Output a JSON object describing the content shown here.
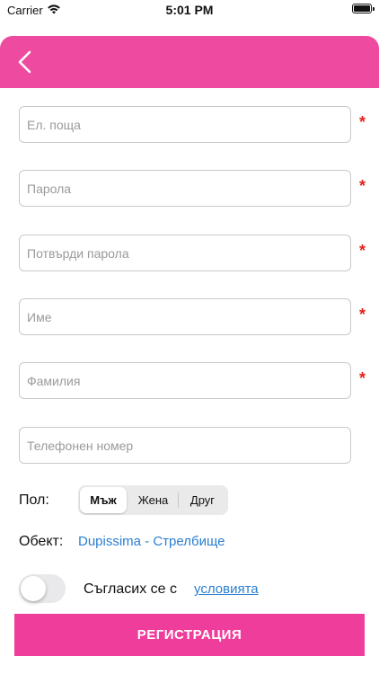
{
  "status_bar": {
    "carrier": "Carrier",
    "time": "5:01 PM",
    "wifi_icon": "wifi-icon",
    "battery_icon": "battery-icon"
  },
  "header": {
    "back_icon": "chevron-left-icon",
    "color": "#ee4ba0"
  },
  "form": {
    "email": {
      "placeholder": "Ел. поща",
      "value": "",
      "required": true
    },
    "password": {
      "placeholder": "Парола",
      "value": "",
      "required": true
    },
    "confirm_password": {
      "placeholder": "Потвърди парола",
      "value": "",
      "required": true
    },
    "first_name": {
      "placeholder": "Име",
      "value": "",
      "required": true
    },
    "last_name": {
      "placeholder": "Фамилия",
      "value": "",
      "required": true
    },
    "phone": {
      "placeholder": "Телефонен номер",
      "value": "",
      "required": false
    },
    "required_marker": "*"
  },
  "gender": {
    "label": "Пол:",
    "options": [
      "Мъж",
      "Жена",
      "Друг"
    ],
    "selected": "Мъж"
  },
  "object": {
    "label": "Обект:",
    "value": "Dupissima - Стрелбище"
  },
  "terms": {
    "toggle_on": false,
    "agree_text": "Съгласих се с",
    "link_text": "условията"
  },
  "register": {
    "label": "РЕГИСТРАЦИЯ",
    "color": "#ef3d9b"
  },
  "colors": {
    "accent": "#ee4ba0",
    "link": "#2a7fd1",
    "required": "#e2231a"
  }
}
